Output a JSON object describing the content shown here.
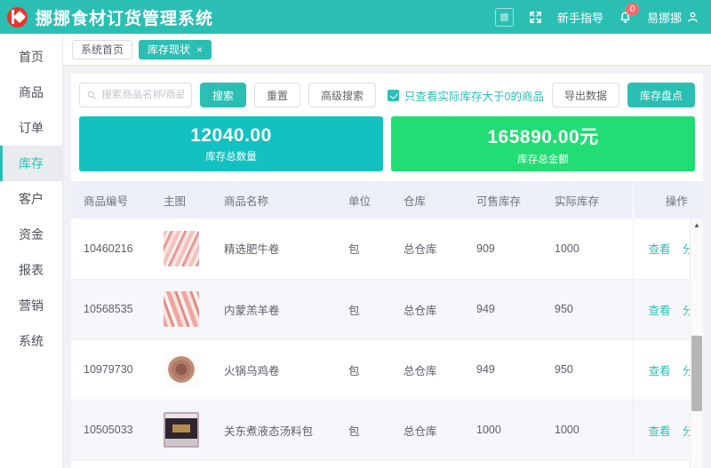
{
  "header": {
    "logo_icon": "app-logo-icon",
    "title": "挪挪食材订货管理系统",
    "square_icon": "minimize-square-icon",
    "fullscreen_icon": "fullscreen-icon",
    "guide_label": "新手指导",
    "bell_icon": "bell-icon",
    "notification_count": "0",
    "username": "易挪挪",
    "user_icon": "user-icon",
    "bg_color": "#2bbfb3"
  },
  "sidebar": {
    "items": [
      {
        "label": "首页",
        "active": false
      },
      {
        "label": "商品",
        "active": false
      },
      {
        "label": "订单",
        "active": false
      },
      {
        "label": "库存",
        "active": true
      },
      {
        "label": "客户",
        "active": false
      },
      {
        "label": "资金",
        "active": false
      },
      {
        "label": "报表",
        "active": false
      },
      {
        "label": "营销",
        "active": false
      },
      {
        "label": "系统",
        "active": false
      }
    ],
    "active_color": "#2bbfb3"
  },
  "tabs": [
    {
      "label": "系统首页",
      "active": false,
      "closable": false
    },
    {
      "label": "库存现状",
      "active": true,
      "closable": true,
      "close_glyph": "×"
    }
  ],
  "toolbar": {
    "search_placeholder": "搜索商品名称/商品编码",
    "search_value": "",
    "search_icon": "search-icon",
    "search_button": "搜索",
    "reset_button": "重置",
    "advanced_button": "高级搜索",
    "checkbox_label": "只查看实际库存大于0的商品",
    "checkbox_checked": true,
    "export_button": "导出数据",
    "stocktake_button": "库存盘点"
  },
  "cards": [
    {
      "value": "12040.00",
      "label": "库存总数量",
      "color": "#13c2c0"
    },
    {
      "value": "165890.00元",
      "label": "库存总金额",
      "color": "#21dd74"
    }
  ],
  "table": {
    "columns": [
      "商品编号",
      "主图",
      "商品名称",
      "单位",
      "仓库",
      "可售库存",
      "实际库存",
      "操作"
    ],
    "rows": [
      {
        "code": "10460216",
        "thumb": "thumb-beef",
        "thumb_name": "product-image-beef-roll",
        "name": "精选肥牛卷",
        "unit": "包",
        "warehouse": "总仓库",
        "sellable": "909",
        "actual": "1000",
        "actions": [
          "查看",
          "分布"
        ]
      },
      {
        "code": "10568535",
        "thumb": "thumb-lamb",
        "thumb_name": "product-image-lamb-roll",
        "name": "内蒙羔羊卷",
        "unit": "包",
        "warehouse": "总仓库",
        "sellable": "949",
        "actual": "950",
        "actions": [
          "查看",
          "分布"
        ]
      },
      {
        "code": "10979730",
        "thumb": "thumb-chicken",
        "thumb_name": "product-image-chicken-roll",
        "name": "火锅乌鸡卷",
        "unit": "包",
        "warehouse": "总仓库",
        "sellable": "949",
        "actual": "950",
        "actions": [
          "查看",
          "分布"
        ]
      },
      {
        "code": "10505033",
        "thumb": "thumb-soup",
        "thumb_name": "product-image-soup-base",
        "name": "关东煮液态汤料包",
        "unit": "包",
        "warehouse": "总仓库",
        "sellable": "1000",
        "actual": "1000",
        "actions": [
          "查看",
          "分布"
        ]
      }
    ]
  },
  "scrollbar": {
    "up_arrow_glyph": "▲"
  }
}
